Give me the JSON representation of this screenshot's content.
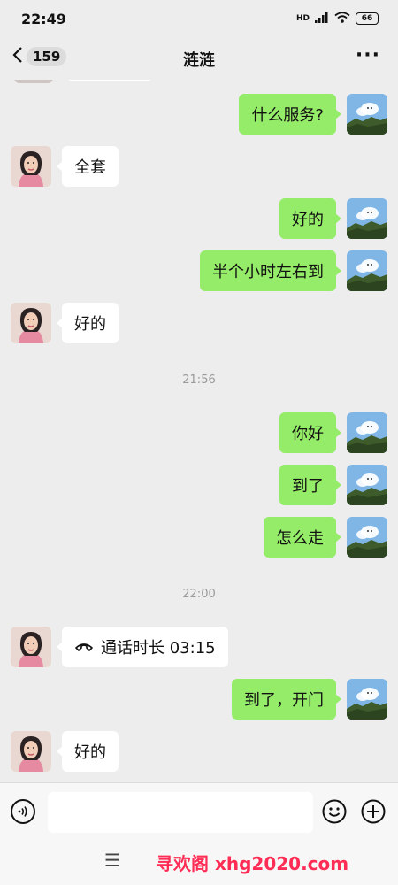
{
  "status": {
    "time": "22:49",
    "network": "HD",
    "battery": "66"
  },
  "header": {
    "back_count": "159",
    "title": "涟涟"
  },
  "messages": {
    "m1": "什么服务?",
    "m2": "全套",
    "m3": "好的",
    "m4": "半个小时左右到",
    "m5": "好的",
    "ts1": "21:56",
    "m6": "你好",
    "m7": "到了",
    "m8": "怎么走",
    "ts2": "22:00",
    "m9": "通话时长 03:15",
    "m10": "到了，开门",
    "m11": "好的"
  },
  "input": {
    "value": ""
  },
  "watermark": "寻欢阁 xhg2020.com",
  "colors": {
    "background": "#ededed",
    "outgoing_bubble": "#95ec69",
    "incoming_bubble": "#ffffff",
    "watermark": "#ff2d55"
  },
  "icons": {
    "back": "chevron-left-icon",
    "more": "more-icon",
    "voice": "voice-icon",
    "emoji": "emoji-icon",
    "plus": "plus-icon",
    "call": "phone-icon",
    "menu": "menu-icon"
  }
}
